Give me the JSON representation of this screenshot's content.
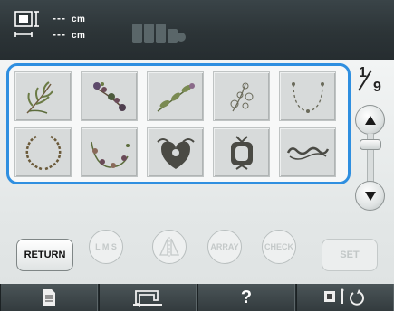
{
  "header": {
    "width_value": "---",
    "width_unit": "cm",
    "height_value": "---",
    "height_unit": "cm"
  },
  "pattern_list": {
    "patterns": [
      {
        "name": "wheat-sprig"
      },
      {
        "name": "flower-spray"
      },
      {
        "name": "leaf-vine"
      },
      {
        "name": "floral-bouquet"
      },
      {
        "name": "wreath-arc"
      },
      {
        "name": "laurel-wreath"
      },
      {
        "name": "floral-crescent"
      },
      {
        "name": "damask-heart"
      },
      {
        "name": "ornate-crest"
      },
      {
        "name": "scroll-border"
      }
    ]
  },
  "page_indicator": {
    "current": "1",
    "total": "9"
  },
  "buttons": {
    "return": "RETURN",
    "lms": "L M S",
    "mirror_icon": "mirror-icon",
    "array": "ARRAY",
    "check": "CHECK",
    "set": "SET"
  },
  "footer": {
    "help": "?"
  },
  "colors": {
    "accent": "#2f8fe0",
    "header_bg": "#2c3437",
    "panel_bg": "#e3e7e7"
  }
}
